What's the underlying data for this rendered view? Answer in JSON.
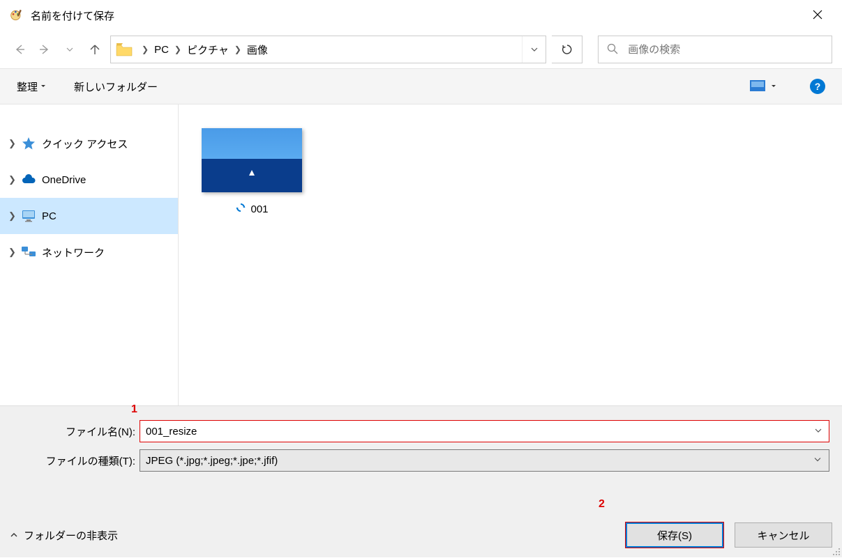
{
  "title": "名前を付けて保存",
  "breadcrumb": {
    "item1": "PC",
    "item2": "ピクチャ",
    "item3": "画像"
  },
  "search": {
    "placeholder": "画像の検索"
  },
  "toolbar": {
    "organize": "整理",
    "newfolder": "新しいフォルダー"
  },
  "sidebar": {
    "quickaccess": "クイック アクセス",
    "onedrive": "OneDrive",
    "pc": "PC",
    "network": "ネットワーク"
  },
  "file": {
    "name": "001"
  },
  "fields": {
    "filename_label": "ファイル名(N):",
    "filename_value": "001_resize",
    "filetype_label": "ファイルの種類(T):",
    "filetype_value": "JPEG (*.jpg;*.jpeg;*.jpe;*.jfif)"
  },
  "footer": {
    "hide_folders": "フォルダーの非表示",
    "save": "保存(S)",
    "cancel": "キャンセル"
  },
  "annotations": {
    "a1": "1",
    "a2": "2"
  }
}
